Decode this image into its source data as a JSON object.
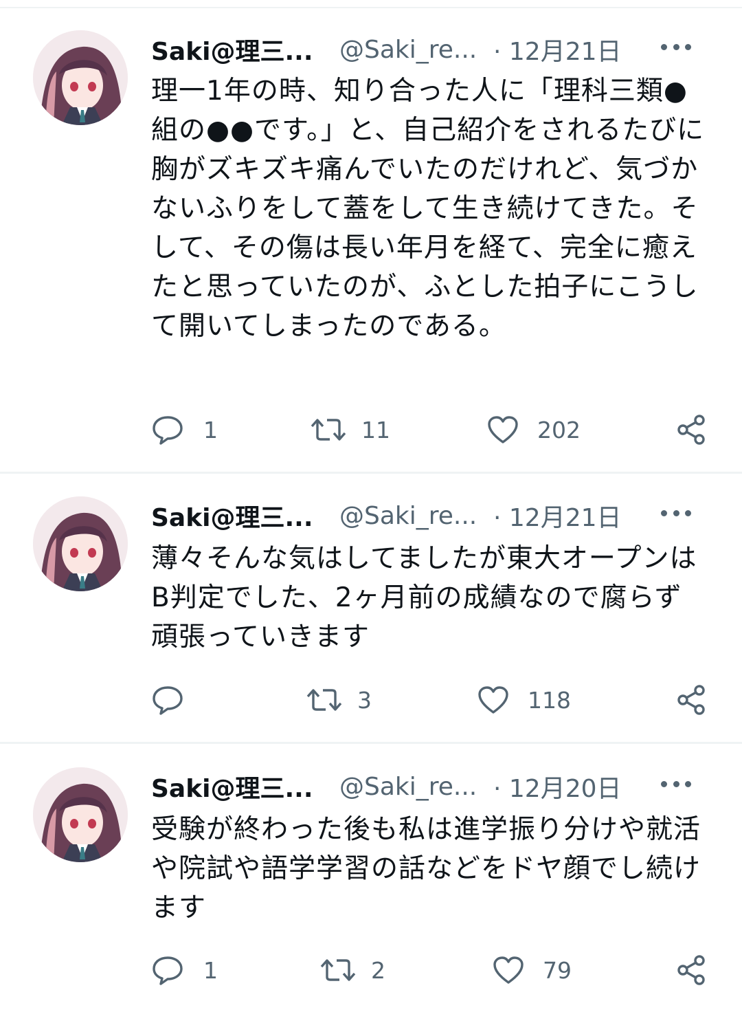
{
  "tweets": [
    {
      "display_name": "Saki@理三...",
      "handle": "@Saki_re...",
      "date": "· 12月21日",
      "text": "理一1年の時、知り合った人に「理科三類●組の●●です。」と、自己紹介をされるたびに胸がズキズキ痛んでいたのだけれど、気づかないふりをして蓋をして生き続けてきた。そして、その傷は長い年月を経て、完全に癒えたと思っていたのが、ふとした拍子にこうして開いてしまったのである。",
      "replies": "1",
      "retweets": "11",
      "likes": "202"
    },
    {
      "display_name": "Saki@理三...",
      "handle": "@Saki_re...",
      "date": "· 12月21日",
      "text": "薄々そんな気はしてましたが東大オープンはB判定でした、2ヶ月前の成績なので腐らず頑張っていきます",
      "replies": "",
      "retweets": "3",
      "likes": "118"
    },
    {
      "display_name": "Saki@理三...",
      "handle": "@Saki_re...",
      "date": "· 12月20日",
      "text": "受験が終わった後も私は進学振り分けや就活や院試や語学学習の話などをドヤ顔でし続けます",
      "replies": "1",
      "retweets": "2",
      "likes": "79"
    }
  ],
  "icons": {
    "reply": "reply-icon",
    "retweet": "retweet-icon",
    "like": "heart-icon",
    "share": "share-icon",
    "more": "more-icon"
  },
  "colors": {
    "text_primary": "#0f1419",
    "text_secondary": "#536471",
    "divider": "#eff3f4"
  }
}
